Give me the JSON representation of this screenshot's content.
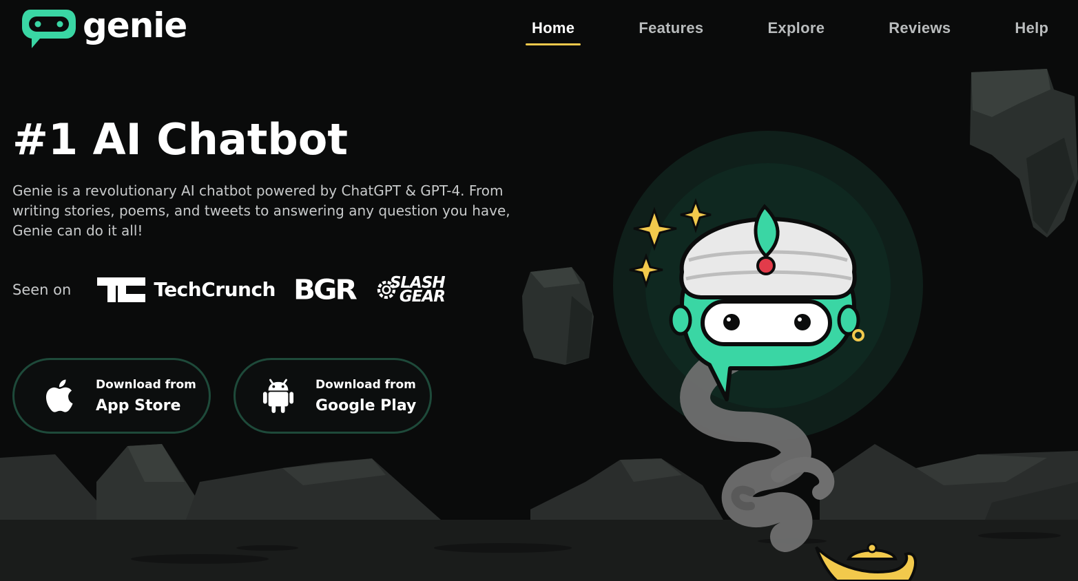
{
  "brand": {
    "name": "genie",
    "accent": "#3ad6a4",
    "gold": "#f2c94c"
  },
  "nav": {
    "items": [
      {
        "label": "Home",
        "active": true
      },
      {
        "label": "Features",
        "active": false
      },
      {
        "label": "Explore",
        "active": false
      },
      {
        "label": "Reviews",
        "active": false
      },
      {
        "label": "Help",
        "active": false
      }
    ]
  },
  "hero": {
    "title": "#1 AI Chatbot",
    "description": "Genie is a revolutionary AI chatbot powered by ChatGPT & GPT-4. From writing stories, poems, and tweets to answering any question you have, Genie can do it all!"
  },
  "seen_on": {
    "label": "Seen on",
    "outlets": [
      "TechCrunch",
      "BGR",
      "SLASH GEAR"
    ],
    "techcrunch_word": "TechCrunch",
    "bgr_word": "BGR",
    "slashgear_line1": "SLASH",
    "slashgear_line2": "GEAR"
  },
  "downloads": {
    "appstore": {
      "small": "Download from",
      "big": "App Store",
      "icon": "apple-icon"
    },
    "googleplay": {
      "small": "Download from",
      "big": "Google Play",
      "icon": "android-icon"
    }
  },
  "colors": {
    "background": "#0a0b0b",
    "mountain": "#2a2d2c",
    "mountain_dark": "#1c1e1d",
    "smoke": "#6f6f6f",
    "button_border": "#1e4a3a"
  }
}
